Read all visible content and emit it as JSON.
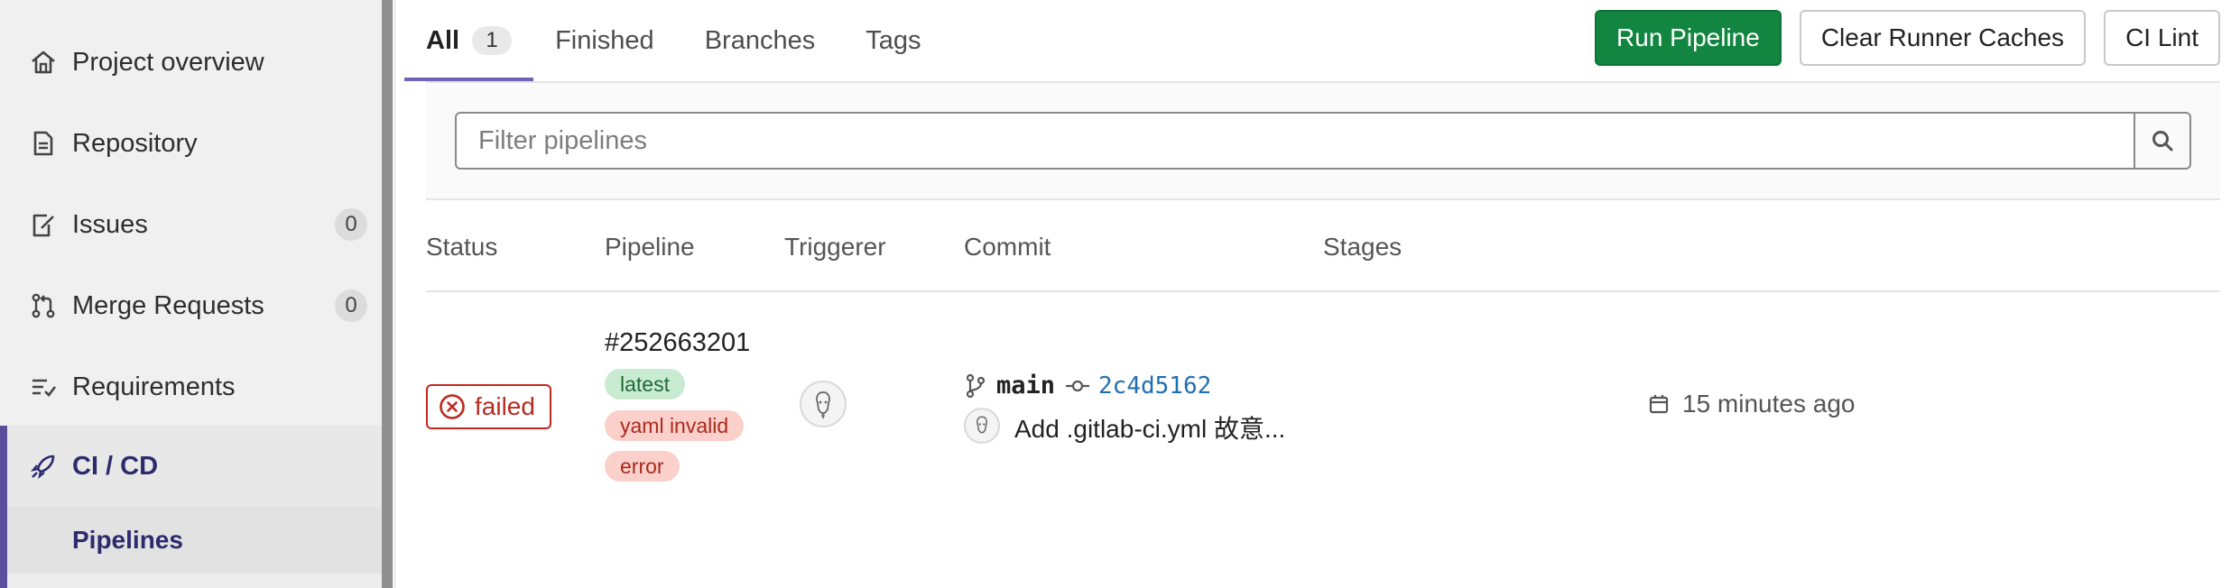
{
  "sidebar": {
    "items": [
      {
        "label": "Project overview",
        "icon": "home-icon"
      },
      {
        "label": "Repository",
        "icon": "document-icon"
      },
      {
        "label": "Issues",
        "icon": "issues-icon",
        "count": "0"
      },
      {
        "label": "Merge Requests",
        "icon": "merge-request-icon",
        "count": "0"
      },
      {
        "label": "Requirements",
        "icon": "requirements-icon"
      },
      {
        "label": "CI / CD",
        "icon": "rocket-icon",
        "active": true
      }
    ],
    "sub_item": "Pipelines"
  },
  "tabs": [
    {
      "label": "All",
      "count": "1",
      "active": true
    },
    {
      "label": "Finished"
    },
    {
      "label": "Branches"
    },
    {
      "label": "Tags"
    }
  ],
  "header_buttons": {
    "run": "Run Pipeline",
    "clear": "Clear Runner Caches",
    "lint": "CI Lint"
  },
  "filter": {
    "placeholder": "Filter pipelines",
    "value": ""
  },
  "table": {
    "columns": [
      "Status",
      "Pipeline",
      "Triggerer",
      "Commit",
      "Stages"
    ],
    "rows": [
      {
        "status": "failed",
        "pipeline_id": "#252663201",
        "labels": [
          "latest",
          "yaml invalid",
          "error"
        ],
        "branch": "main",
        "sha": "2c4d5162",
        "commit_title": "Add .gitlab-ci.yml 故意...",
        "time_ago": "15 minutes ago"
      }
    ]
  },
  "colors": {
    "accent": "#6e63b5",
    "primary_button": "#128641",
    "failed": "#c0281e",
    "link": "#1f6fb2"
  }
}
